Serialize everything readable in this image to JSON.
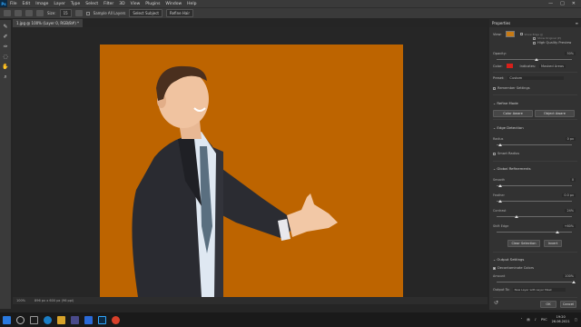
{
  "app": {
    "logo": "Ps"
  },
  "menubar": {
    "items": [
      "File",
      "Edit",
      "Image",
      "Layer",
      "Type",
      "Select",
      "Filter",
      "3D",
      "View",
      "Plugins",
      "Window",
      "Help"
    ]
  },
  "options": {
    "size_label": "Size:",
    "size_value": "15",
    "sample_all_layers": "Sample All Layers",
    "select_subject": "Select Subject",
    "refine_hair": "Refine Hair"
  },
  "document": {
    "tab_title": "1.jpg @ 100% (Layer 0, RGB/8#) *",
    "status_zoom": "100%",
    "status_info": "896 px x 600 px (96 ppi)"
  },
  "properties": {
    "title": "Properties",
    "view_label": "View:",
    "show_edge": "Show Edge (J)",
    "show_original": "Show Original (P)",
    "high_quality_preview": "High Quality Preview",
    "opacity_label": "Opacity:",
    "opacity_value": "50%",
    "color_label": "Color:",
    "color_swatch": "#d8201a",
    "indicates_label": "Indicates:",
    "indicates_value": "Masked Areas",
    "preset_label": "Preset:",
    "preset_value": "Custom",
    "remember_settings": "Remember Settings",
    "refine_mode": "Refine Mode",
    "color_aware": "Color Aware",
    "object_aware": "Object Aware",
    "edge_detection": "Edge Detection",
    "radius_label": "Radius",
    "radius_value": "0 px",
    "radius_pos": 0.02,
    "smart_radius": "Smart Radius",
    "global_refinements": "Global Refinements",
    "smooth_label": "Smooth",
    "smooth_value": "0",
    "smooth_pos": 0.02,
    "feather_label": "Feather",
    "feather_value": "0.0 px",
    "feather_pos": 0.02,
    "contrast_label": "Contrast",
    "contrast_value": "24%",
    "contrast_pos": 0.24,
    "shift_edge_label": "Shift Edge",
    "shift_edge_value": "+60%",
    "shift_edge_pos": 0.78,
    "clear_selection": "Clear Selection",
    "invert": "Invert",
    "output_settings": "Output Settings",
    "decontaminate": "Decontaminate Colors",
    "amount_label": "Amount",
    "amount_value": "100%",
    "amount_pos": 1.0,
    "output_to_label": "Output To:",
    "output_to_value": "New Layer with Layer Mask",
    "ok": "OK",
    "cancel": "Cancel"
  },
  "taskbar": {
    "icons": [
      "windows-icon",
      "search-icon",
      "task-view-icon",
      "edge-icon",
      "files-icon",
      "store-icon",
      "mail-icon",
      "photoshop-icon",
      "chrome-icon"
    ],
    "lang": "РУС",
    "time": "19:20",
    "date": "26.06.2021"
  }
}
